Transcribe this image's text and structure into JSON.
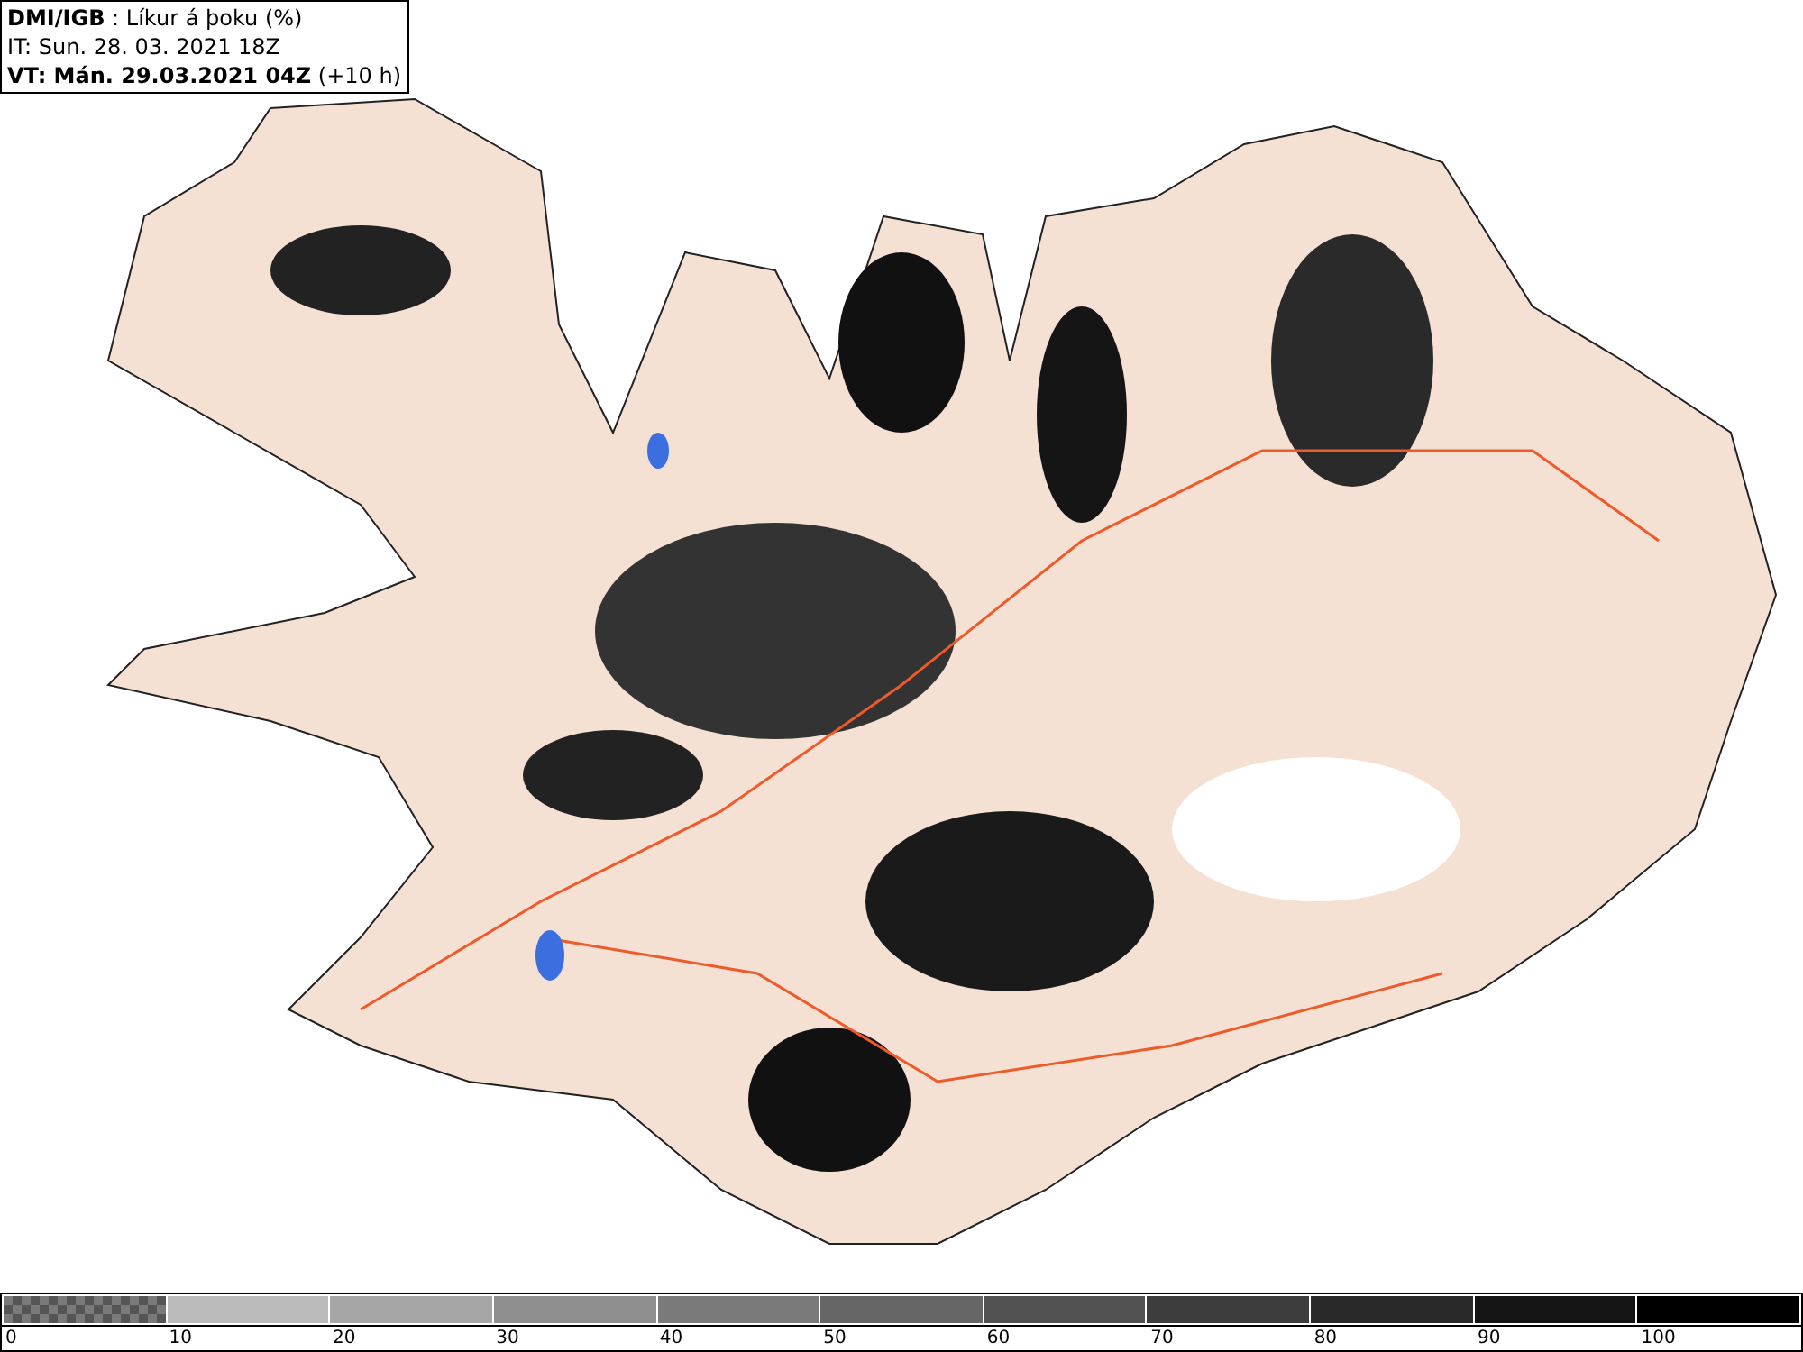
{
  "header": {
    "lines": [
      "**DMI/IGB** : Líkur á þoku (%)",
      "IT: Sun. 28. 03. 2021 18Z",
      "**VT: Mán. 29.03.2021 04Z** (+10 h)"
    ]
  },
  "legend": {
    "segments": [
      {
        "kind": "checker",
        "color": "#7a7a7a",
        "label": "0"
      },
      {
        "kind": "solid",
        "color": "#bbbbbb",
        "label": "10"
      },
      {
        "kind": "solid",
        "color": "#a6a6a6",
        "label": "20"
      },
      {
        "kind": "solid",
        "color": "#8f8f8f",
        "label": "30"
      },
      {
        "kind": "solid",
        "color": "#7a7a7a",
        "label": "40"
      },
      {
        "kind": "solid",
        "color": "#666666",
        "label": "50"
      },
      {
        "kind": "solid",
        "color": "#525252",
        "label": "60"
      },
      {
        "kind": "solid",
        "color": "#3d3d3d",
        "label": "70"
      },
      {
        "kind": "solid",
        "color": "#292929",
        "label": "80"
      },
      {
        "kind": "solid",
        "color": "#141414",
        "label": "90"
      },
      {
        "kind": "solid",
        "color": "#000000",
        "label": "100"
      }
    ]
  }
}
